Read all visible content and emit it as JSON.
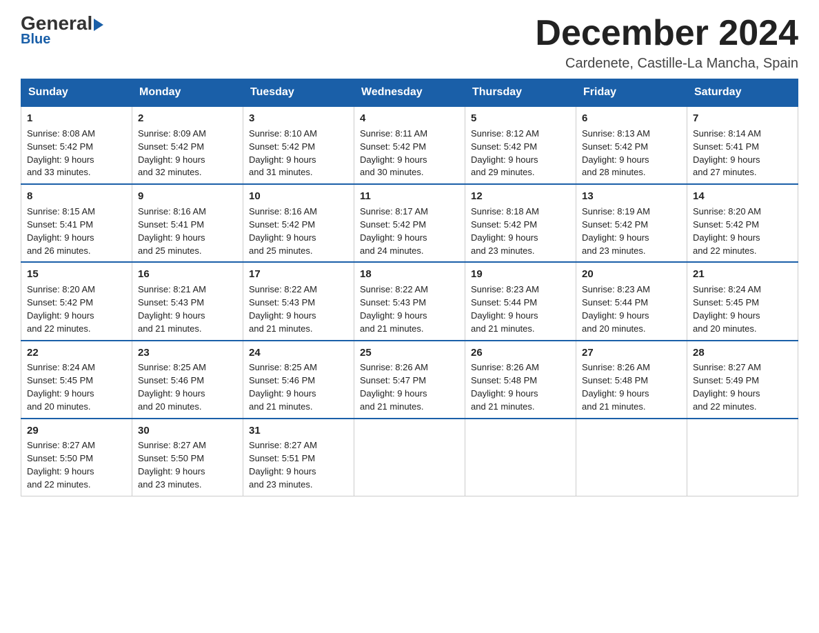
{
  "logo": {
    "general": "General",
    "arrow": "",
    "blue": "Blue"
  },
  "header": {
    "month": "December 2024",
    "location": "Cardenete, Castille-La Mancha, Spain"
  },
  "days": [
    "Sunday",
    "Monday",
    "Tuesday",
    "Wednesday",
    "Thursday",
    "Friday",
    "Saturday"
  ],
  "weeks": [
    [
      {
        "num": "1",
        "sunrise": "8:08 AM",
        "sunset": "5:42 PM",
        "daylight": "9 hours and 33 minutes."
      },
      {
        "num": "2",
        "sunrise": "8:09 AM",
        "sunset": "5:42 PM",
        "daylight": "9 hours and 32 minutes."
      },
      {
        "num": "3",
        "sunrise": "8:10 AM",
        "sunset": "5:42 PM",
        "daylight": "9 hours and 31 minutes."
      },
      {
        "num": "4",
        "sunrise": "8:11 AM",
        "sunset": "5:42 PM",
        "daylight": "9 hours and 30 minutes."
      },
      {
        "num": "5",
        "sunrise": "8:12 AM",
        "sunset": "5:42 PM",
        "daylight": "9 hours and 29 minutes."
      },
      {
        "num": "6",
        "sunrise": "8:13 AM",
        "sunset": "5:42 PM",
        "daylight": "9 hours and 28 minutes."
      },
      {
        "num": "7",
        "sunrise": "8:14 AM",
        "sunset": "5:41 PM",
        "daylight": "9 hours and 27 minutes."
      }
    ],
    [
      {
        "num": "8",
        "sunrise": "8:15 AM",
        "sunset": "5:41 PM",
        "daylight": "9 hours and 26 minutes."
      },
      {
        "num": "9",
        "sunrise": "8:16 AM",
        "sunset": "5:41 PM",
        "daylight": "9 hours and 25 minutes."
      },
      {
        "num": "10",
        "sunrise": "8:16 AM",
        "sunset": "5:42 PM",
        "daylight": "9 hours and 25 minutes."
      },
      {
        "num": "11",
        "sunrise": "8:17 AM",
        "sunset": "5:42 PM",
        "daylight": "9 hours and 24 minutes."
      },
      {
        "num": "12",
        "sunrise": "8:18 AM",
        "sunset": "5:42 PM",
        "daylight": "9 hours and 23 minutes."
      },
      {
        "num": "13",
        "sunrise": "8:19 AM",
        "sunset": "5:42 PM",
        "daylight": "9 hours and 23 minutes."
      },
      {
        "num": "14",
        "sunrise": "8:20 AM",
        "sunset": "5:42 PM",
        "daylight": "9 hours and 22 minutes."
      }
    ],
    [
      {
        "num": "15",
        "sunrise": "8:20 AM",
        "sunset": "5:42 PM",
        "daylight": "9 hours and 22 minutes."
      },
      {
        "num": "16",
        "sunrise": "8:21 AM",
        "sunset": "5:43 PM",
        "daylight": "9 hours and 21 minutes."
      },
      {
        "num": "17",
        "sunrise": "8:22 AM",
        "sunset": "5:43 PM",
        "daylight": "9 hours and 21 minutes."
      },
      {
        "num": "18",
        "sunrise": "8:22 AM",
        "sunset": "5:43 PM",
        "daylight": "9 hours and 21 minutes."
      },
      {
        "num": "19",
        "sunrise": "8:23 AM",
        "sunset": "5:44 PM",
        "daylight": "9 hours and 21 minutes."
      },
      {
        "num": "20",
        "sunrise": "8:23 AM",
        "sunset": "5:44 PM",
        "daylight": "9 hours and 20 minutes."
      },
      {
        "num": "21",
        "sunrise": "8:24 AM",
        "sunset": "5:45 PM",
        "daylight": "9 hours and 20 minutes."
      }
    ],
    [
      {
        "num": "22",
        "sunrise": "8:24 AM",
        "sunset": "5:45 PM",
        "daylight": "9 hours and 20 minutes."
      },
      {
        "num": "23",
        "sunrise": "8:25 AM",
        "sunset": "5:46 PM",
        "daylight": "9 hours and 20 minutes."
      },
      {
        "num": "24",
        "sunrise": "8:25 AM",
        "sunset": "5:46 PM",
        "daylight": "9 hours and 21 minutes."
      },
      {
        "num": "25",
        "sunrise": "8:26 AM",
        "sunset": "5:47 PM",
        "daylight": "9 hours and 21 minutes."
      },
      {
        "num": "26",
        "sunrise": "8:26 AM",
        "sunset": "5:48 PM",
        "daylight": "9 hours and 21 minutes."
      },
      {
        "num": "27",
        "sunrise": "8:26 AM",
        "sunset": "5:48 PM",
        "daylight": "9 hours and 21 minutes."
      },
      {
        "num": "28",
        "sunrise": "8:27 AM",
        "sunset": "5:49 PM",
        "daylight": "9 hours and 22 minutes."
      }
    ],
    [
      {
        "num": "29",
        "sunrise": "8:27 AM",
        "sunset": "5:50 PM",
        "daylight": "9 hours and 22 minutes."
      },
      {
        "num": "30",
        "sunrise": "8:27 AM",
        "sunset": "5:50 PM",
        "daylight": "9 hours and 23 minutes."
      },
      {
        "num": "31",
        "sunrise": "8:27 AM",
        "sunset": "5:51 PM",
        "daylight": "9 hours and 23 minutes."
      },
      null,
      null,
      null,
      null
    ]
  ]
}
